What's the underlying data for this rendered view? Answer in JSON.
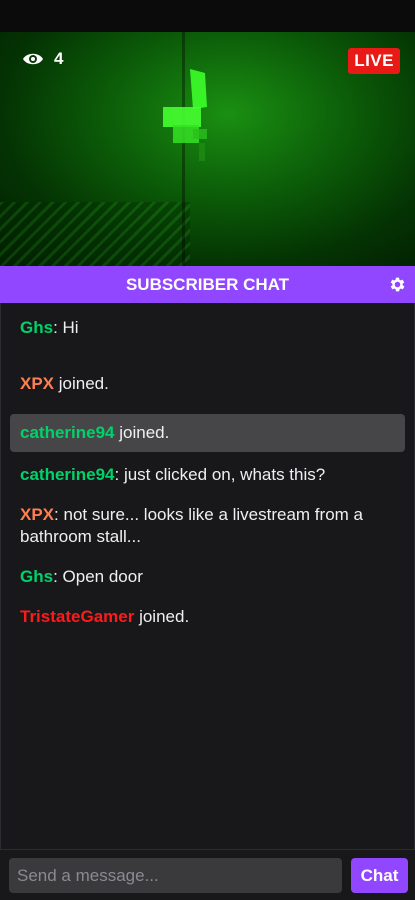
{
  "stream": {
    "viewer_count": "4",
    "live_label": "LIVE",
    "colors": {
      "live": "#e91916",
      "night_vision": "#0b5a08"
    }
  },
  "chat": {
    "title": "SUBSCRIBER CHAT",
    "accent": "#9147ff",
    "messages": [
      {
        "user": "Ghs",
        "sep": ": ",
        "text": "Hi",
        "color": "#00d26a",
        "highlight": false
      },
      {
        "user": "XPX",
        "sep": " ",
        "text": "joined.",
        "color": "#ff7f50",
        "highlight": false
      },
      {
        "user": "catherine94",
        "sep": " ",
        "text": "joined.",
        "color": "#00d26a",
        "highlight": true
      },
      {
        "user": "catherine94",
        "sep": ": ",
        "text": "just clicked on, whats this?",
        "color": "#00d26a",
        "highlight": false
      },
      {
        "user": "XPX",
        "sep": ": ",
        "text": "not sure... looks like a livestream from a bathroom stall...",
        "color": "#ff7f50",
        "highlight": false
      },
      {
        "user": "Ghs",
        "sep": ": ",
        "text": "Open door",
        "color": "#00d26a",
        "highlight": false
      },
      {
        "user": "TristateGamer",
        "sep": " ",
        "text": "joined.",
        "color": "#ff1a1a",
        "highlight": false
      }
    ]
  },
  "input": {
    "placeholder": "Send a message...",
    "value": "",
    "send_label": "Chat"
  },
  "icons": {
    "viewers": "eye-icon",
    "settings": "gear-icon"
  }
}
